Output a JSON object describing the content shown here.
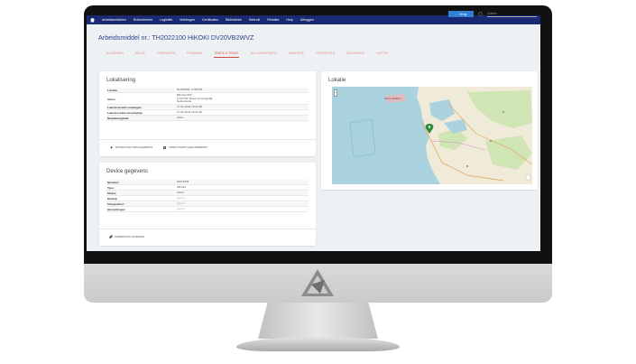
{
  "nav": {
    "items": [
      "Arbeidsmiddelen",
      "Rollenbeheer",
      "Logistiek",
      "Meldingen",
      "Certificaten",
      "Bibliotheek",
      "Gebruik",
      "Relaties",
      "Help",
      "Uitloggen"
    ]
  },
  "header": {
    "title": "Arbeidsmiddel nr.: TH2022100 HiKOKI DV20VB2WVZ",
    "back_label": "← Terug",
    "search_placeholder": "Zoeken"
  },
  "tabs": [
    {
      "label": "ALGEMEEN",
      "active": false
    },
    {
      "label": "KEUZE",
      "active": false
    },
    {
      "label": "GEBRUIKER",
      "active": false
    },
    {
      "label": "PLANNING",
      "active": false
    },
    {
      "label": "TRACK & TRACE",
      "active": true
    },
    {
      "label": "BIJ-LAGEN/TAKEN",
      "active": false
    },
    {
      "label": "MONTAGE",
      "active": false
    },
    {
      "label": "CONTROLES",
      "active": false
    },
    {
      "label": "MELDINGEN",
      "active": false
    },
    {
      "label": "NOTITIE",
      "active": false
    }
  ],
  "lokalisering": {
    "title": "Lokalisering",
    "rows": [
      {
        "key": "Locatie:",
        "value": "52.878230, 4.755781"
      },
      {
        "key": "Adres:",
        "value": [
          "Bijlmaat 666",
          "1723 PW, Broek op Langedijk",
          "Netherlands"
        ]
      },
      {
        "key": "Laatste bericht ontvangen:",
        "value": "27-01-2023 15:21:08"
      },
      {
        "key": "Laatste locatie bevestiging:",
        "value": "27-01-2023 15:21:08"
      },
      {
        "key": "Nauwkeurigheid:",
        "value": "100m"
      }
    ],
    "actions": [
      "DOWNLOAD GESCHIEDENIS",
      "OPEN KAART GESCHIEDENIS"
    ]
  },
  "device": {
    "title": "Device gegevens",
    "rows": [
      {
        "key": "Nummer:",
        "value": "20071666",
        "muted": false
      },
      {
        "key": "Type:",
        "value": "GB 914",
        "muted": false
      },
      {
        "key": "Status:",
        "value": "Actief",
        "muted": false
      },
      {
        "key": "Batterij:",
        "value": "(geen)",
        "muted": true
      },
      {
        "key": "Temperatuur:",
        "value": "(geen)",
        "muted": true
      },
      {
        "key": "Opmerkingen:",
        "value": "(geen)",
        "muted": true
      }
    ],
    "action": "OPMERKING WIJZIGEN"
  },
  "lokatie": {
    "title": "Lokatie",
    "map_label": "Marker Wadden",
    "zoom_in": "+",
    "zoom_out": "-",
    "colors": {
      "water": "#aad3df",
      "land": "#f0ead8",
      "green": "#cfe5b4"
    }
  }
}
